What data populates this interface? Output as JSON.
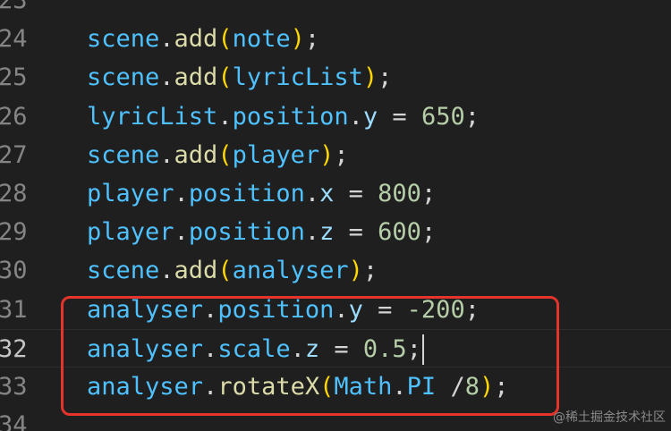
{
  "editor": {
    "lines": [
      {
        "number": "23",
        "parts": []
      },
      {
        "number": "24",
        "parts": [
          {
            "t": "scene",
            "c": "v"
          },
          {
            "t": ".",
            "c": "o"
          },
          {
            "t": "add",
            "c": "f"
          },
          {
            "t": "(",
            "c": "b"
          },
          {
            "t": "note",
            "c": "v"
          },
          {
            "t": ")",
            "c": "b"
          },
          {
            "t": ";",
            "c": "o"
          }
        ]
      },
      {
        "number": "25",
        "parts": [
          {
            "t": "scene",
            "c": "v"
          },
          {
            "t": ".",
            "c": "o"
          },
          {
            "t": "add",
            "c": "f"
          },
          {
            "t": "(",
            "c": "b"
          },
          {
            "t": "lyricList",
            "c": "v"
          },
          {
            "t": ")",
            "c": "b"
          },
          {
            "t": ";",
            "c": "o"
          }
        ]
      },
      {
        "number": "26",
        "parts": [
          {
            "t": "lyricList",
            "c": "v"
          },
          {
            "t": ".",
            "c": "o"
          },
          {
            "t": "position",
            "c": "v"
          },
          {
            "t": ".",
            "c": "o"
          },
          {
            "t": "y",
            "c": "p"
          },
          {
            "t": " = ",
            "c": "o"
          },
          {
            "t": "650",
            "c": "n"
          },
          {
            "t": ";",
            "c": "o"
          }
        ]
      },
      {
        "number": "27",
        "parts": [
          {
            "t": "scene",
            "c": "v"
          },
          {
            "t": ".",
            "c": "o"
          },
          {
            "t": "add",
            "c": "f"
          },
          {
            "t": "(",
            "c": "b"
          },
          {
            "t": "player",
            "c": "v"
          },
          {
            "t": ")",
            "c": "b"
          },
          {
            "t": ";",
            "c": "o"
          }
        ]
      },
      {
        "number": "28",
        "parts": [
          {
            "t": "player",
            "c": "v"
          },
          {
            "t": ".",
            "c": "o"
          },
          {
            "t": "position",
            "c": "v"
          },
          {
            "t": ".",
            "c": "o"
          },
          {
            "t": "x",
            "c": "p"
          },
          {
            "t": " = ",
            "c": "o"
          },
          {
            "t": "800",
            "c": "n"
          },
          {
            "t": ";",
            "c": "o"
          }
        ]
      },
      {
        "number": "29",
        "parts": [
          {
            "t": "player",
            "c": "v"
          },
          {
            "t": ".",
            "c": "o"
          },
          {
            "t": "position",
            "c": "v"
          },
          {
            "t": ".",
            "c": "o"
          },
          {
            "t": "z",
            "c": "p"
          },
          {
            "t": " = ",
            "c": "o"
          },
          {
            "t": "600",
            "c": "n"
          },
          {
            "t": ";",
            "c": "o"
          }
        ]
      },
      {
        "number": "30",
        "parts": [
          {
            "t": "scene",
            "c": "v"
          },
          {
            "t": ".",
            "c": "o"
          },
          {
            "t": "add",
            "c": "f"
          },
          {
            "t": "(",
            "c": "b"
          },
          {
            "t": "analyser",
            "c": "v"
          },
          {
            "t": ")",
            "c": "b"
          },
          {
            "t": ";",
            "c": "o"
          }
        ]
      },
      {
        "number": "31",
        "parts": [
          {
            "t": "analyser",
            "c": "v"
          },
          {
            "t": ".",
            "c": "o"
          },
          {
            "t": "position",
            "c": "v"
          },
          {
            "t": ".",
            "c": "o"
          },
          {
            "t": "y",
            "c": "p"
          },
          {
            "t": " = ",
            "c": "o"
          },
          {
            "t": "-200",
            "c": "n"
          },
          {
            "t": ";",
            "c": "o"
          }
        ]
      },
      {
        "number": "32",
        "current": true,
        "caret": true,
        "parts": [
          {
            "t": "analyser",
            "c": "v"
          },
          {
            "t": ".",
            "c": "o"
          },
          {
            "t": "scale",
            "c": "v"
          },
          {
            "t": ".",
            "c": "o"
          },
          {
            "t": "z",
            "c": "p"
          },
          {
            "t": " = ",
            "c": "o"
          },
          {
            "t": "0.5",
            "c": "n"
          },
          {
            "t": ";",
            "c": "o"
          }
        ]
      },
      {
        "number": "33",
        "parts": [
          {
            "t": "analyser",
            "c": "v"
          },
          {
            "t": ".",
            "c": "o"
          },
          {
            "t": "rotateX",
            "c": "f"
          },
          {
            "t": "(",
            "c": "b"
          },
          {
            "t": "Math",
            "c": "v"
          },
          {
            "t": ".",
            "c": "o"
          },
          {
            "t": "PI",
            "c": "v"
          },
          {
            "t": " /",
            "c": "o"
          },
          {
            "t": "8",
            "c": "n"
          },
          {
            "t": ")",
            "c": "b"
          },
          {
            "t": ";",
            "c": "o"
          }
        ]
      },
      {
        "number": "34",
        "parts": []
      }
    ]
  },
  "watermark": {
    "text": "@稀土掘金技术社区"
  },
  "colors": {
    "background": "#1f1f1f",
    "highlight_box": "#e5342c"
  }
}
